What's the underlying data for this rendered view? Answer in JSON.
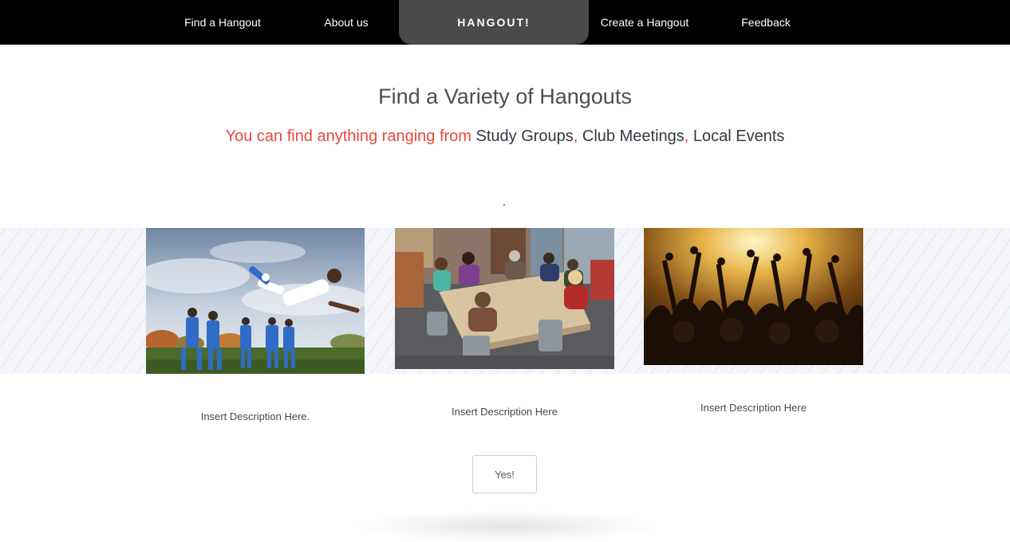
{
  "nav": {
    "items": [
      {
        "label": "Find a Hangout"
      },
      {
        "label": "About us"
      },
      {
        "label": "Create a Hangout"
      },
      {
        "label": "Feedback"
      }
    ],
    "brand": "HANGOUT!"
  },
  "hero": {
    "title": "Find a Variety of Hangouts",
    "subtitle_lead": "You can find anything ranging from ",
    "terms": [
      "Study Groups",
      "Club Meetings",
      "Local Events"
    ],
    "separator": ", "
  },
  "gallery": {
    "items": [
      {
        "image": "soccer-players-photo",
        "description": "Insert Description Here."
      },
      {
        "image": "study-group-table-photo",
        "description": "Insert Description Here"
      },
      {
        "image": "concert-crowd-photo",
        "description": "Insert Description Here"
      }
    ]
  },
  "cta": {
    "label": "Yes!"
  },
  "colors": {
    "nav_bg": "#000000",
    "brand_bg": "#4a4a4a",
    "accent_red": "#e8473d",
    "heading": "#4a4f55"
  }
}
